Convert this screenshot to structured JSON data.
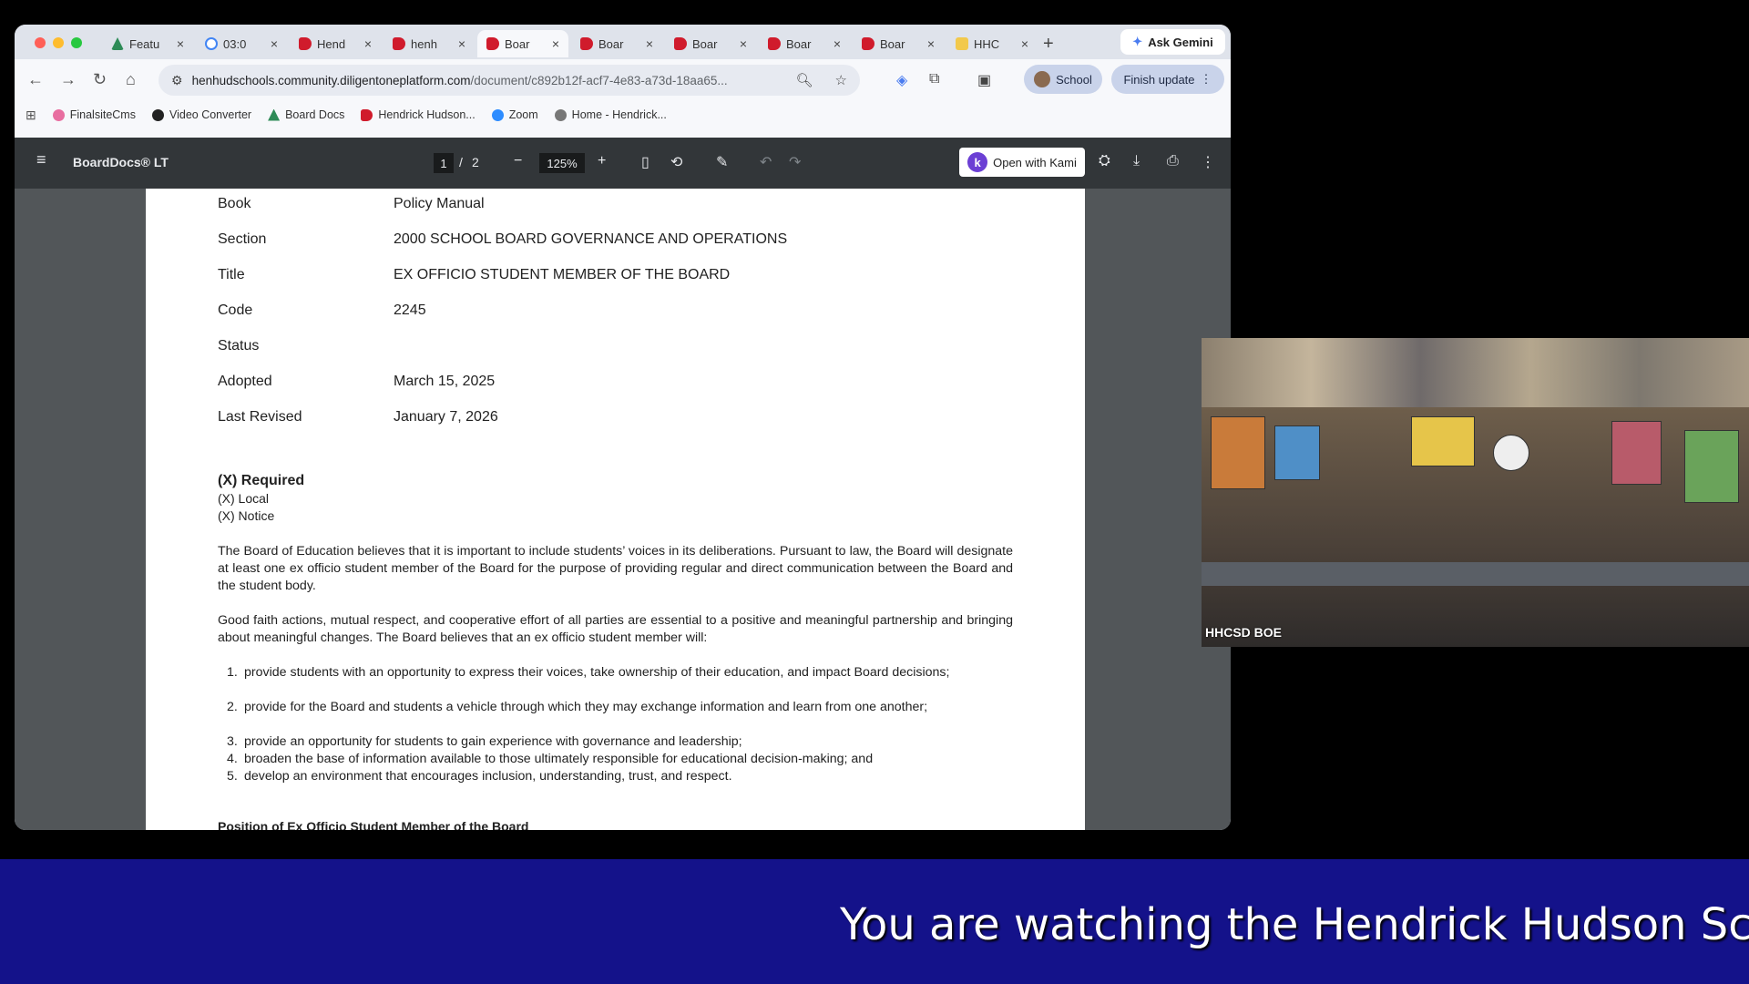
{
  "browser": {
    "tabs": [
      {
        "label": "Featu",
        "icon": "feature-icon"
      },
      {
        "label": "03:0",
        "icon": "google-icon"
      },
      {
        "label": "Hend",
        "icon": "boarddocs-icon"
      },
      {
        "label": "henh",
        "icon": "boarddocs-icon"
      },
      {
        "label": "Boar",
        "icon": "boarddocs-icon",
        "active": true
      },
      {
        "label": "Boar",
        "icon": "boarddocs-icon"
      },
      {
        "label": "Boar",
        "icon": "boarddocs-icon"
      },
      {
        "label": "Boar",
        "icon": "boarddocs-icon"
      },
      {
        "label": "Boar",
        "icon": "boarddocs-icon"
      },
      {
        "label": "HHC",
        "icon": "slides-icon"
      }
    ],
    "new_tab": "+",
    "ask_gemini": "Ask Gemini",
    "url_host": "henhudschools.community.diligentoneplatform.com",
    "url_path": "/document/c892b12f-acf7-4e83-a73d-18aa65...",
    "profile": "School",
    "finish_update": "Finish update",
    "bookmarks": [
      "FinalsiteCms",
      "Video Converter",
      "Board Docs",
      "Hendrick Hudson...",
      "Zoom",
      "Home - Hendrick..."
    ]
  },
  "pdf": {
    "app_title": "BoardDocs® LT",
    "page_current": "1",
    "page_sep": "/",
    "page_total": "2",
    "zoom": "125%",
    "open_with_kami": "Open with Kami",
    "kami_letter": "k"
  },
  "document": {
    "meta": [
      {
        "label": "Book",
        "value": "Policy Manual"
      },
      {
        "label": "Section",
        "value": "2000 SCHOOL BOARD GOVERNANCE AND OPERATIONS"
      },
      {
        "label": "Title",
        "value": "EX OFFICIO STUDENT MEMBER OF THE BOARD"
      },
      {
        "label": "Code",
        "value": "2245"
      },
      {
        "label": "Status",
        "value": ""
      },
      {
        "label": "Adopted",
        "value": "March 15, 2025"
      },
      {
        "label": "Last Revised",
        "value": "January 7, 2026"
      }
    ],
    "required": "(X) Required",
    "local": "(X) Local",
    "notice": "(X) Notice",
    "para1": "The Board of Education believes that it is important to include students’ voices in its deliberations. Pursuant to law, the Board will designate at least one ex officio student member of the Board for the purpose of providing regular and direct communication between the Board and the student body.",
    "para2": "Good faith actions, mutual respect, and cooperative effort of all parties are essential to a positive and meaningful partnership and bringing about meaningful changes. The Board believes that an ex officio student member will:",
    "list": [
      "provide students with an opportunity to express their voices, take ownership of their education, and impact Board decisions;",
      "provide for the Board and students a vehicle through which they may exchange information and learn from one another;",
      "provide an opportunity for students to gain experience with governance and leadership;",
      "broaden the base of information available to those ultimately responsible for educational decision-making; and",
      "develop an environment that encourages inclusion, understanding, trust, and respect."
    ],
    "next_heading": "Position of Ex Officio Student Member of the Board"
  },
  "video": {
    "label": "HHCSD BOE"
  },
  "ticker": {
    "text": "You are watching the Hendrick Hudson Sch"
  }
}
